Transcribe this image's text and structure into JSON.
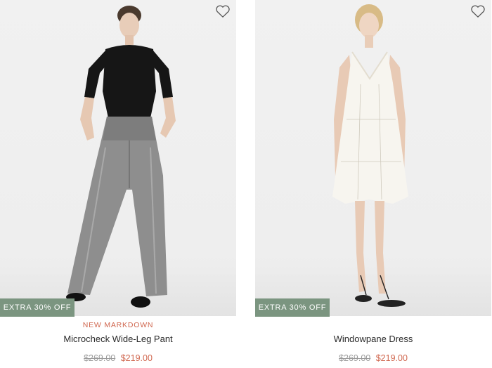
{
  "products": [
    {
      "badge": "EXTRA 30% OFF",
      "flag": "NEW MARKDOWN",
      "name": "Microcheck Wide-Leg Pant",
      "original_price": "$269.00",
      "sale_price": "$219.00",
      "wishlist_icon": "heart-outline-icon"
    },
    {
      "badge": "EXTRA 30% OFF",
      "flag": "",
      "name": "Windowpane Dress",
      "original_price": "$269.00",
      "sale_price": "$219.00",
      "wishlist_icon": "heart-outline-icon"
    }
  ],
  "colors": {
    "badge_bg": "#7b9580",
    "sale_red": "#d0674f",
    "strike_grey": "#9a9a9a"
  }
}
